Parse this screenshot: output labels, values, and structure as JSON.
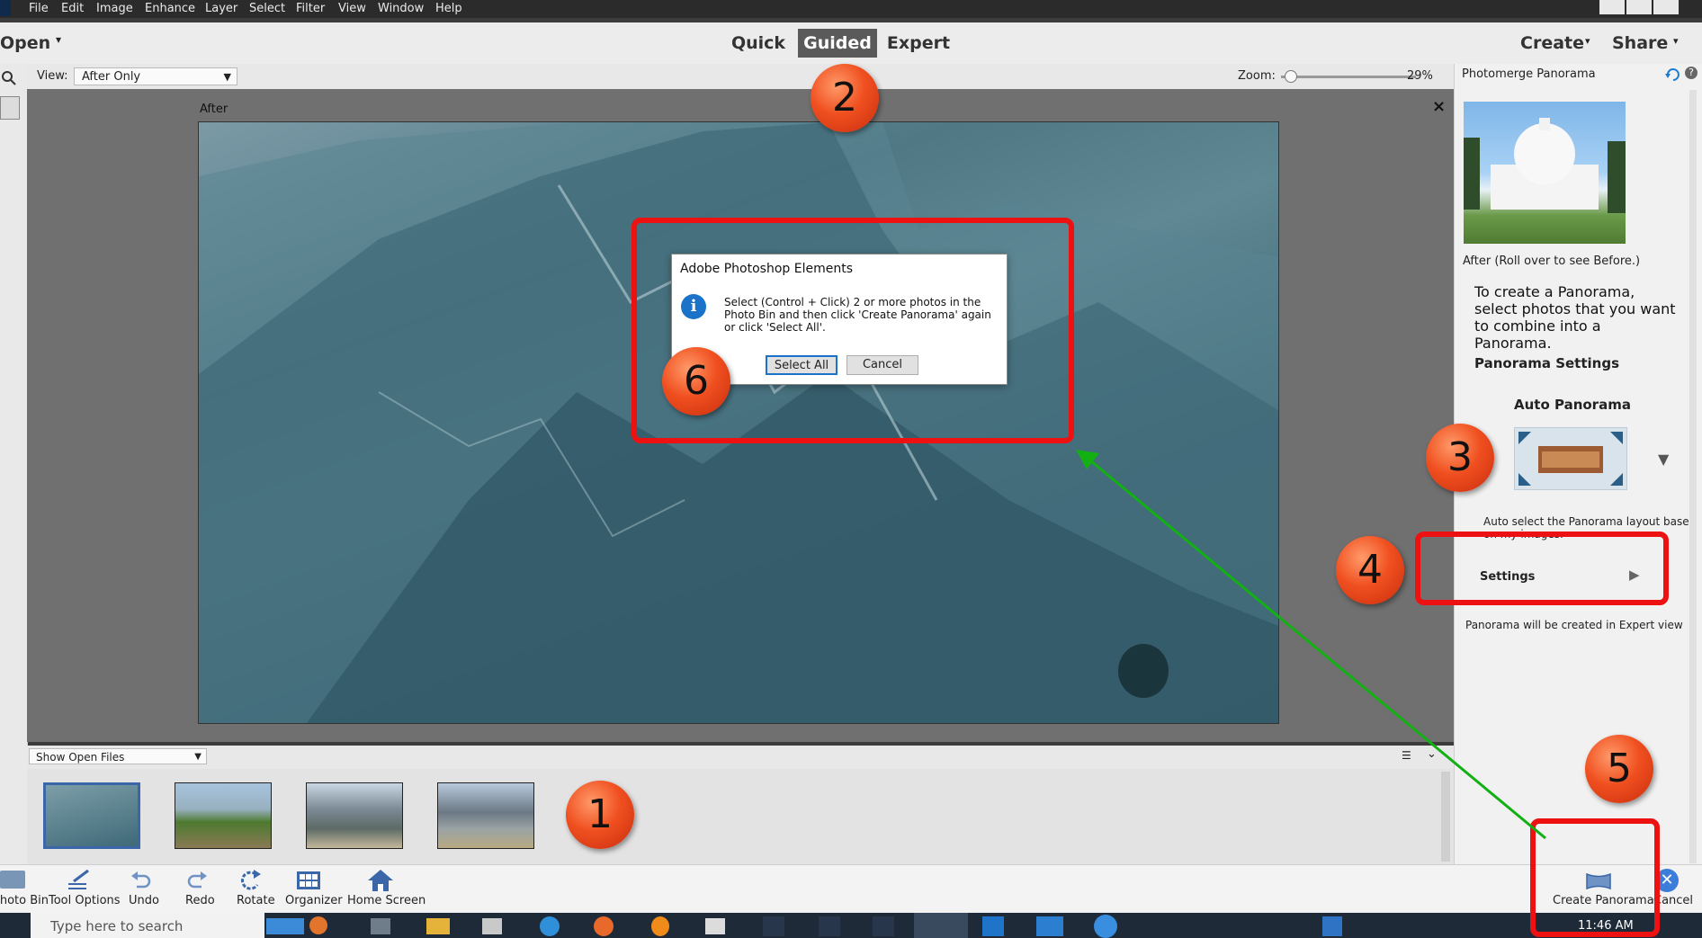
{
  "menubar": {
    "items": [
      "File",
      "Edit",
      "Image",
      "Enhance",
      "Layer",
      "Select",
      "Filter",
      "View",
      "Window",
      "Help"
    ]
  },
  "modebar": {
    "open_label": "Open",
    "tabs": [
      "Quick",
      "Guided",
      "Expert"
    ],
    "active_tab": "Guided",
    "create_label": "Create",
    "share_label": "Share"
  },
  "viewbar": {
    "view_label": "View:",
    "view_value": "After Only",
    "zoom_label": "Zoom:",
    "zoom_value": "29%",
    "zoom_level": 0.29
  },
  "canvas": {
    "after_label": "After",
    "close_glyph": "×"
  },
  "dialog": {
    "title": "Adobe Photoshop Elements",
    "message": "Select (Control + Click) 2 or more photos in the Photo Bin and then click 'Create Panorama' again or click 'Select All'.",
    "select_all": "Select All",
    "cancel": "Cancel"
  },
  "rightpanel": {
    "title": "Photomerge Panorama",
    "caption": "After (Roll over to see Before.)",
    "instructions": "To create a Panorama, select photos that you want to combine into a Panorama.",
    "settings_heading": "Panorama Settings",
    "layout_name": "Auto Panorama",
    "layout_desc": "Auto select the Panorama layout based on my images.",
    "settings_label": "Settings",
    "note": "Panorama will be created in Expert view"
  },
  "bin": {
    "show_label": "Show Open Files"
  },
  "bottombar": {
    "photo_bin": "Photo Bin",
    "tool_options": "Tool Options",
    "undo": "Undo",
    "redo": "Redo",
    "rotate": "Rotate",
    "organizer": "Organizer",
    "home_screen": "Home Screen",
    "create_panorama": "Create Panorama",
    "cancel": "Cancel"
  },
  "taskbar": {
    "search_placeholder": "Type here to search",
    "time": "11:46 AM"
  },
  "callouts": [
    "1",
    "2",
    "3",
    "4",
    "5",
    "6"
  ],
  "colors": {
    "callout_red": "#ee1111",
    "arrow_green": "#12b012",
    "guided_tab_bg": "#5a5a5a",
    "info_blue": "#1a73c9"
  }
}
